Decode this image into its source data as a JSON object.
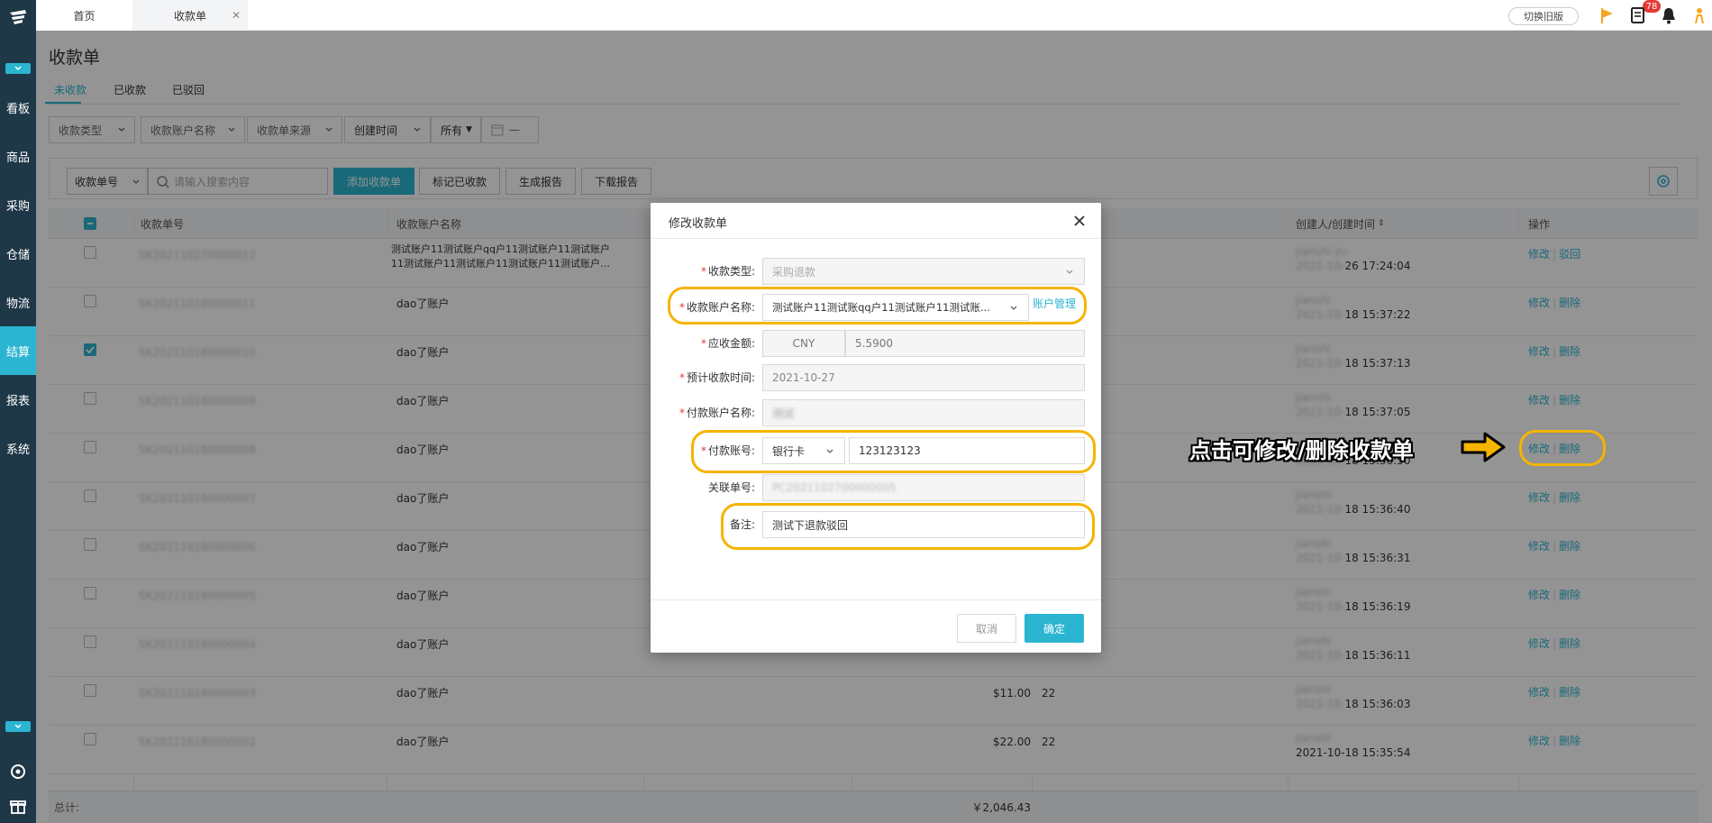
{
  "sidebar": {
    "items": [
      {
        "label": "看板"
      },
      {
        "label": "商品"
      },
      {
        "label": "采购"
      },
      {
        "label": "仓储"
      },
      {
        "label": "物流"
      },
      {
        "label": "结算",
        "active": true
      },
      {
        "label": "报表"
      },
      {
        "label": "系统"
      }
    ]
  },
  "topbar": {
    "tabs": [
      {
        "label": "首页"
      },
      {
        "label": "收款单"
      }
    ],
    "switch_old": "切换旧版",
    "notification_count": "78"
  },
  "page": {
    "title": "收款单",
    "status_tabs": [
      {
        "label": "未收款",
        "active": true
      },
      {
        "label": "已收款"
      },
      {
        "label": "已驳回"
      }
    ]
  },
  "filters": {
    "type": "收款类型",
    "account_name": "收款账户名称",
    "source": "收款单来源",
    "created_time": "创建时间",
    "all": "所有"
  },
  "toolbar": {
    "search_field": "收款单号",
    "search_placeholder": "请输入搜索内容",
    "add": "添加收款单",
    "mark_received": "标记已收款",
    "generate_report": "生成报告",
    "download_report": "下载报告"
  },
  "table": {
    "columns": {
      "order_no": "收款单号",
      "account_name": "收款账户名称",
      "creator_time": "创建人/创建时间",
      "actions": "操作"
    },
    "rows": [
      {
        "order_no": "SK202110270000012",
        "account": "测试账户11测试账户qq户11测试账户11测试账户",
        "account2": "11测试账户11测试账户11测试账户11测试账户…",
        "amount": "",
        "qty": "",
        "creator": "jianshi.yu",
        "time": "2021-10-26 17:24:04",
        "time_prefix": "2021-10-",
        "time_suffix": "26 17:24:04",
        "op1": "修改",
        "op2": "驳回",
        "checked": false
      },
      {
        "order_no": "SK202110180000011",
        "account": "dao了账户",
        "amount": "",
        "qty": "",
        "creator": "jianshi",
        "time_prefix": "2021-10-",
        "time_suffix": "18 15:37:22",
        "op1": "修改",
        "op2": "删除",
        "checked": false
      },
      {
        "order_no": "SK202110180000010",
        "account": "dao了账户",
        "amount": "",
        "qty": "",
        "creator": "jianshi",
        "time_prefix": "2021-10-",
        "time_suffix": "18 15:37:13",
        "op1": "修改",
        "op2": "删除",
        "checked": true
      },
      {
        "order_no": "SK202110180000009",
        "account": "dao了账户",
        "amount": "",
        "qty": "",
        "creator": "jianshi",
        "time_prefix": "2021-10-",
        "time_suffix": "18 15:37:05",
        "op1": "修改",
        "op2": "删除",
        "checked": false
      },
      {
        "order_no": "SK202110180000008",
        "account": "dao了账户",
        "amount": "",
        "qty": "",
        "creator": "jianshi",
        "time_prefix": "2021-10-",
        "time_suffix": "18 15:36:50",
        "op1": "修改",
        "op2": "删除",
        "checked": false
      },
      {
        "order_no": "SK202110180000007",
        "account": "dao了账户",
        "amount": "",
        "qty": "",
        "creator": "jianshi",
        "time_prefix": "2021-10-",
        "time_suffix": "18 15:36:40",
        "op1": "修改",
        "op2": "删除",
        "checked": false
      },
      {
        "order_no": "SK202110180000006",
        "account": "dao了账户",
        "amount": "",
        "qty": "",
        "creator": "jianshi",
        "time_prefix": "2021-10-",
        "time_suffix": "18 15:36:31",
        "op1": "修改",
        "op2": "删除",
        "checked": false
      },
      {
        "order_no": "SK202110180000005",
        "account": "dao了账户",
        "amount": "",
        "qty": "",
        "creator": "jianshi",
        "time_prefix": "2021-10-",
        "time_suffix": "18 15:36:19",
        "op1": "修改",
        "op2": "删除",
        "checked": false
      },
      {
        "order_no": "SK202110180000004",
        "account": "dao了账户",
        "amount": "",
        "qty": "",
        "creator": "jianshi",
        "time_prefix": "2021-10-",
        "time_suffix": "18 15:36:11",
        "op1": "修改",
        "op2": "删除",
        "checked": false
      },
      {
        "order_no": "SK202110180000003",
        "account": "dao了账户",
        "amount": "$11.00",
        "qty": "22",
        "creator": "jianshi",
        "time_prefix": "2021-10-",
        "time_suffix": "18 15:36:03",
        "op1": "修改",
        "op2": "删除",
        "checked": false
      },
      {
        "order_no": "SK202110180000002",
        "account": "dao了账户",
        "amount": "$22.00",
        "qty": "22",
        "creator": "jianshi",
        "time_prefix": "",
        "time_suffix": "2021-10-18 15:35:54",
        "op1": "修改",
        "op2": "删除",
        "checked": false
      }
    ],
    "totals_label": "总计:",
    "totals_amount": "￥2,046.43"
  },
  "modal": {
    "title": "修改收款单",
    "fields": {
      "type_label": "收款类型:",
      "type_value": "采购退款",
      "account_label": "收款账户名称:",
      "account_value": "测试账户11测试账qq户11测试账户11测试账...",
      "account_manage": "账户管理",
      "amount_label": "应收金额:",
      "amount_currency": "CNY",
      "amount_value": "5.5900",
      "date_label": "预计收款时间:",
      "date_value": "2021-10-27",
      "payer_label": "付款账户名称:",
      "payer_value": "测试",
      "payer_no_label": "付款账号:",
      "payer_no_type": "银行卡",
      "payer_no_value": "123123123",
      "related_label": "关联单号:",
      "related_value": "PC2021102700000005",
      "remark_label": "备注:",
      "remark_value": "测试下退款驳回"
    },
    "cancel": "取消",
    "ok": "确定"
  },
  "annotation": {
    "text": "点击可修改/删除收款单",
    "color": "#f5b400"
  },
  "colors": {
    "accent": "#2bb5d1",
    "sidebar": "#1f3848",
    "highlight": "#f5b400"
  }
}
